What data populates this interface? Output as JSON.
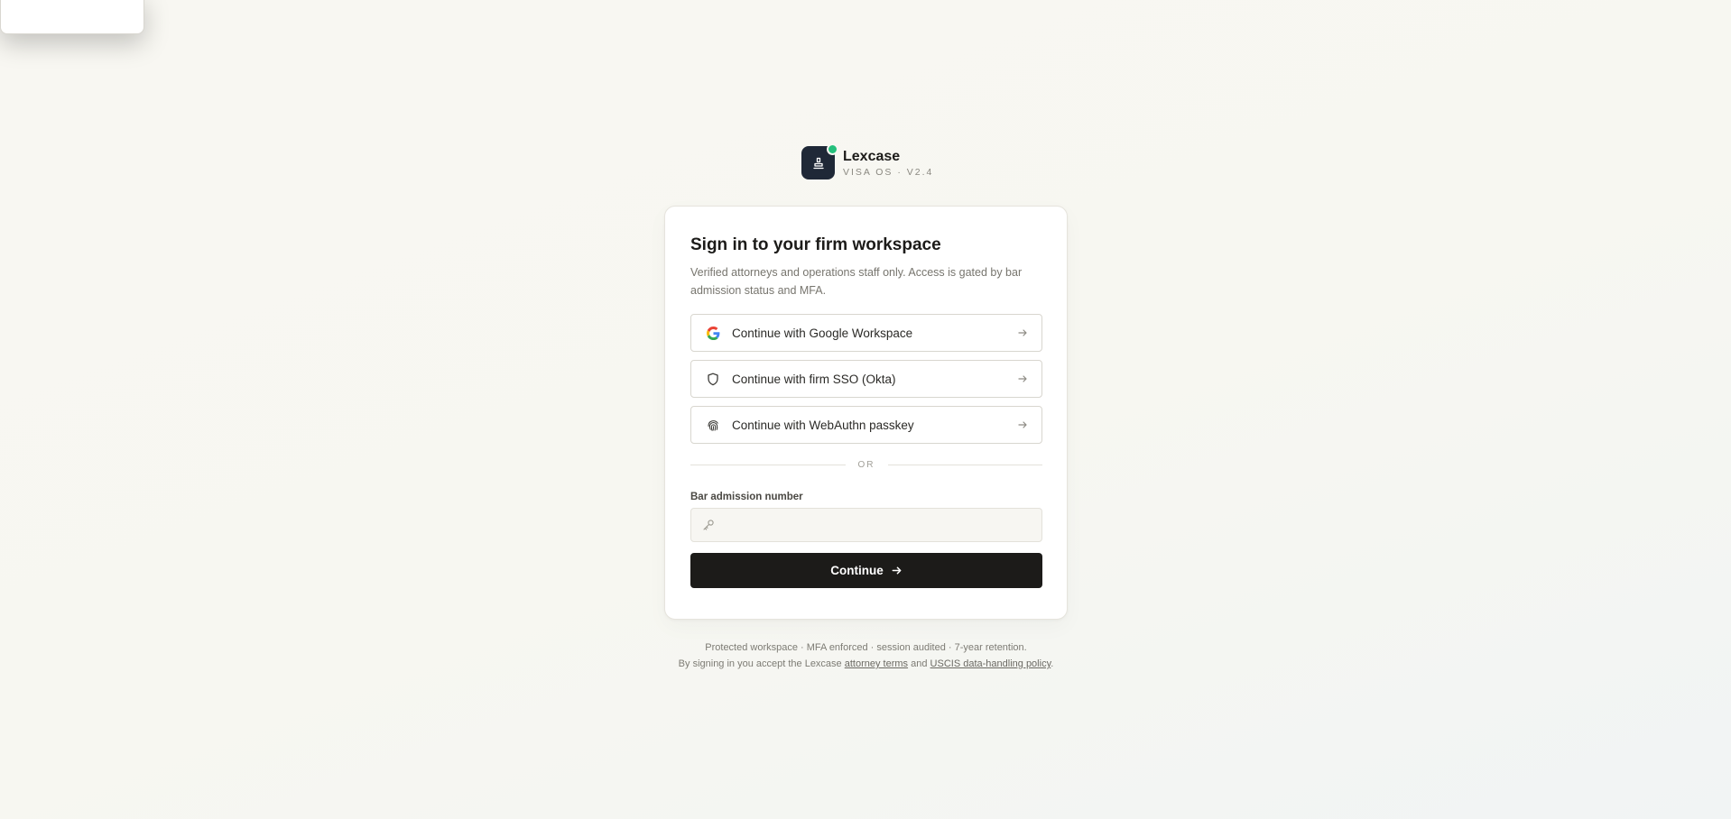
{
  "brand": {
    "name": "Lexcase",
    "subtitle": "VISA OS · V2.4"
  },
  "card": {
    "title": "Sign in to your firm workspace",
    "description": "Verified attorneys and operations staff only. Access is gated by bar admission status and MFA."
  },
  "auth_options": [
    {
      "label": "Continue with Google Workspace",
      "icon": "google-icon"
    },
    {
      "label": "Continue with firm SSO (Okta)",
      "icon": "shield-icon"
    },
    {
      "label": "Continue with WebAuthn passkey",
      "icon": "fingerprint-icon"
    }
  ],
  "divider_text": "OR",
  "bar_field": {
    "label": "Bar admission number",
    "value": "",
    "placeholder": "",
    "icon": "key-icon"
  },
  "continue_button": {
    "label": "Continue",
    "icon": "arrow-right-icon"
  },
  "footer": {
    "line1": "Protected workspace · MFA enforced · session audited · 7-year retention.",
    "line2_prefix": "By signing in you accept the Lexcase",
    "terms_link": "attorney terms",
    "line2_and": "and",
    "policy_link": "USCIS data-handling policy",
    "line2_suffix": "."
  },
  "colors": {
    "accent_dark": "#1c1b19",
    "logo_bg": "#1f2837",
    "status_dot": "#25c07c",
    "background": "#f8f7f2"
  }
}
